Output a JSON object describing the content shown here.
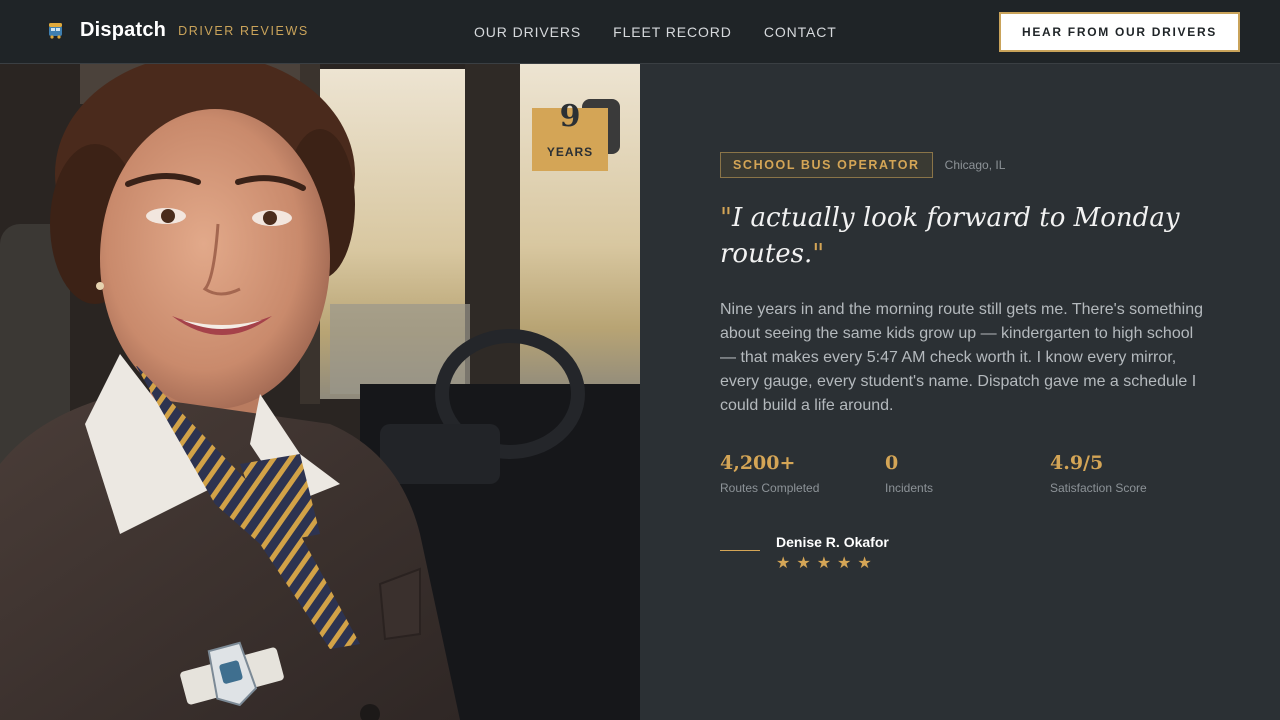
{
  "header": {
    "brand_name": "Dispatch",
    "brand_tagline": "DRIVER REVIEWS",
    "nav": [
      "OUR DRIVERS",
      "FLEET RECORD",
      "CONTACT"
    ],
    "cta_label": "HEAR FROM OUR DRIVERS"
  },
  "photo": {
    "years_value": "9",
    "years_label": "YEARS"
  },
  "testimonial": {
    "role": "SCHOOL BUS OPERATOR",
    "location": "Chicago, IL",
    "quote": "I actually look forward to Monday routes.",
    "story": "Nine years in and the morning route still gets me. There's something about seeing the same kids grow up — kindergarten to high school — that makes every 5:47 AM check worth it. I know every mirror, every gauge, every student's name. Dispatch gave me a schedule I could build a life around.",
    "stats": [
      {
        "value": "4,200+",
        "label": "Routes Completed"
      },
      {
        "value": "0",
        "label": "Incidents"
      },
      {
        "value": "4.9/5",
        "label": "Satisfaction Score"
      }
    ],
    "author": "Denise R. Okafor",
    "rating": 5
  },
  "colors": {
    "accent": "#d4a556",
    "panel_bg": "#2b3034",
    "header_bg": "#1f2427"
  }
}
